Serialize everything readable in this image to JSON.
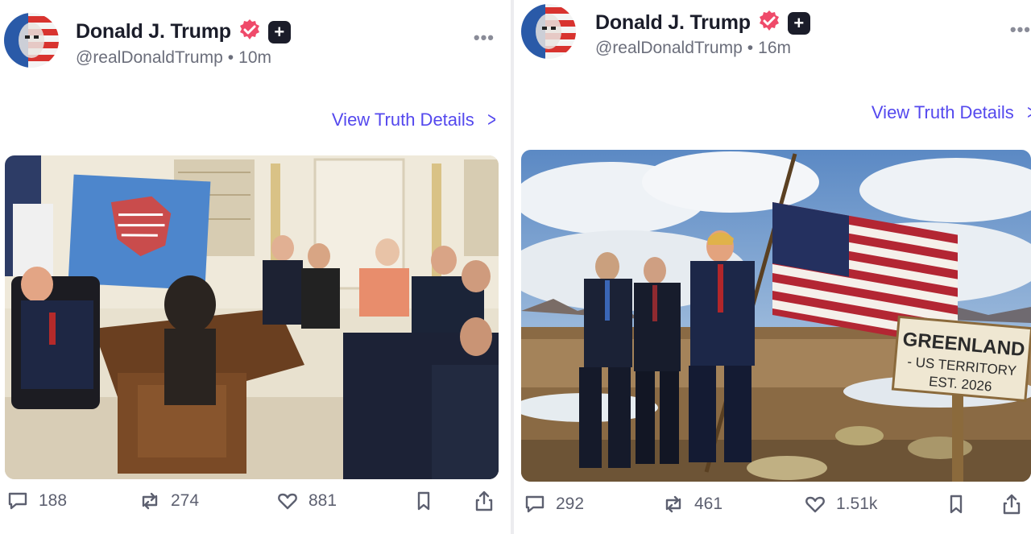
{
  "posts": [
    {
      "author_name": "Donald J. Trump",
      "handle": "@realDonaldTrump",
      "separator": "•",
      "time": "10m",
      "details_link": "View Truth Details",
      "counts": {
        "replies": "188",
        "retruths": "274",
        "likes": "881"
      },
      "icons": {
        "more": "more-icon",
        "verified": "verified-badge-icon",
        "plus": "plus-badge-icon"
      }
    },
    {
      "author_name": "Donald J. Trump",
      "handle": "@realDonaldTrump",
      "separator": "•",
      "time": "16m",
      "details_link": "View Truth Details",
      "counts": {
        "replies": "292",
        "retruths": "461",
        "likes": "1.51k"
      },
      "sign": {
        "line1": "GREENLAND",
        "line2": "- US TERRITORY",
        "line3": "EST. 2026"
      },
      "icons": {
        "more": "more-icon",
        "verified": "verified-badge-icon",
        "plus": "plus-badge-icon"
      }
    }
  ],
  "colors": {
    "link": "#5448ee",
    "verified": "#ef4a6a",
    "text": "#1b1d2a",
    "muted": "#6b6e7b"
  }
}
